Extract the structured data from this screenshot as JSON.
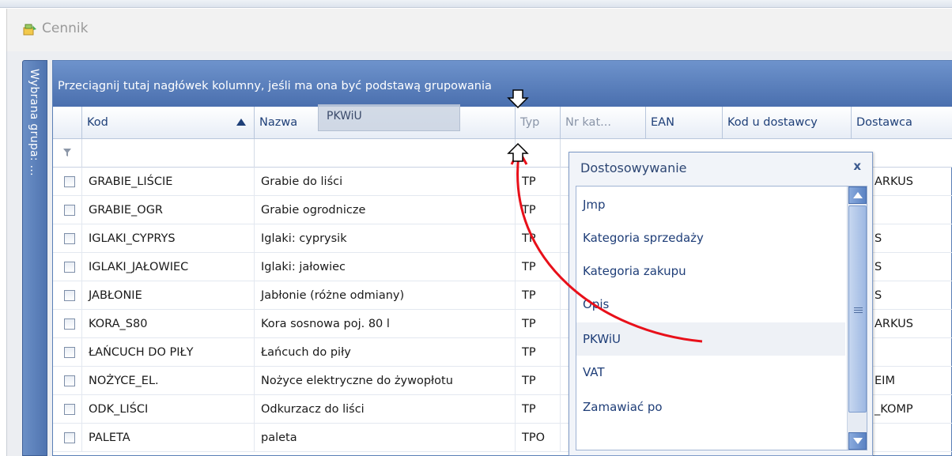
{
  "window": {
    "title": "Cennik",
    "icon": "price-list-icon"
  },
  "side_panel": {
    "label": "Wybrana grupa: ..."
  },
  "grid": {
    "group_by_hint": "Przeciągnij tutaj nagłówek kolumny, jeśli ma ona być podstawą grupowania",
    "columns": [
      "Kod",
      "Nazwa",
      "Typ",
      "Nr kat...",
      "EAN",
      "Kod u dostawcy",
      "Dostawca"
    ],
    "sorted_column": "Kod",
    "sort_direction": "ascending",
    "dragged_column": "PKWiU",
    "rows": [
      {
        "kod": "GRABIE_LIŚCIE",
        "nazwa": "Grabie do liści",
        "typ": "TP",
        "dostawca": "ARKUS"
      },
      {
        "kod": "GRABIE_OGR",
        "nazwa": "Grabie ogrodnicze",
        "typ": "TP",
        "dostawca": ""
      },
      {
        "kod": "IGLAKI_CYPRYS",
        "nazwa": "Iglaki: cyprysik",
        "typ": "TP",
        "dostawca": "S"
      },
      {
        "kod": "IGLAKI_JAŁOWIEC",
        "nazwa": "Iglaki: jałowiec",
        "typ": "TP",
        "dostawca": "S"
      },
      {
        "kod": "JABŁONIE",
        "nazwa": "Jabłonie (różne odmiany)",
        "typ": "TP",
        "dostawca": "S"
      },
      {
        "kod": "KORA_S80",
        "nazwa": "Kora sosnowa poj. 80 l",
        "typ": "TP",
        "dostawca": "ARKUS"
      },
      {
        "kod": "ŁAŃCUCH DO PIŁY",
        "nazwa": "Łańcuch do piły",
        "typ": "TP",
        "dostawca": ""
      },
      {
        "kod": "NOŻYCE_EL.",
        "nazwa": "Nożyce elektryczne do żywopłotu",
        "typ": "TP",
        "dostawca": "EIM"
      },
      {
        "kod": "ODK_LIŚCI",
        "nazwa": "Odkurzacz do liści",
        "typ": "TP",
        "dostawca": "_KOMP"
      },
      {
        "kod": "PALETA",
        "nazwa": "paleta",
        "typ": "TPO",
        "dostawca": ""
      }
    ]
  },
  "customization": {
    "title": "Dostosowywanie",
    "close_label": "x",
    "items": [
      "Jmp",
      "Kategoria sprzedaży",
      "Kategoria zakupu",
      "Opis",
      "PKWiU",
      "VAT",
      "Zamawiać po"
    ],
    "highlighted_item": "PKWiU"
  },
  "colors": {
    "group_panel": "#5a7fbf",
    "header_text": "#1e3f78",
    "drag_arrow": "#e8101a"
  }
}
